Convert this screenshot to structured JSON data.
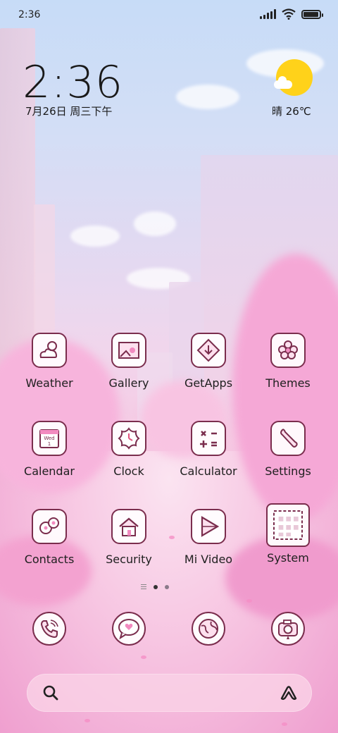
{
  "status_bar": {
    "time": "2:36"
  },
  "clock_widget": {
    "time": "2:36",
    "date": "7月26日 周三下午"
  },
  "weather_widget": {
    "text": "晴 26℃",
    "icon": "sunny-cloud-icon"
  },
  "apps": [
    {
      "label": "Weather",
      "icon": "weather-icon"
    },
    {
      "label": "Gallery",
      "icon": "gallery-icon"
    },
    {
      "label": "GetApps",
      "icon": "getapps-icon"
    },
    {
      "label": "Themes",
      "icon": "themes-icon"
    },
    {
      "label": "Calendar",
      "icon": "calendar-icon",
      "icon_text": [
        "Wed",
        "1"
      ]
    },
    {
      "label": "Clock",
      "icon": "clock-icon"
    },
    {
      "label": "Calculator",
      "icon": "calculator-icon"
    },
    {
      "label": "Settings",
      "icon": "settings-icon"
    },
    {
      "label": "Contacts",
      "icon": "contacts-icon"
    },
    {
      "label": "Security",
      "icon": "security-icon"
    },
    {
      "label": "Mi Video",
      "icon": "mi-video-icon"
    },
    {
      "label": "System",
      "icon": "system-folder-icon"
    }
  ],
  "page_indicator": {
    "pages": 2,
    "current": 1
  },
  "dock": [
    {
      "icon": "phone-icon"
    },
    {
      "icon": "messages-icon"
    },
    {
      "icon": "browser-icon"
    },
    {
      "icon": "camera-icon"
    }
  ],
  "search_bar": {
    "left_icon": "search-icon",
    "right_icon": "assistant-icon"
  },
  "colors": {
    "icon_stroke": "#7a2d4d",
    "icon_fill": "#ffffff",
    "sun": "#ffd21a"
  }
}
